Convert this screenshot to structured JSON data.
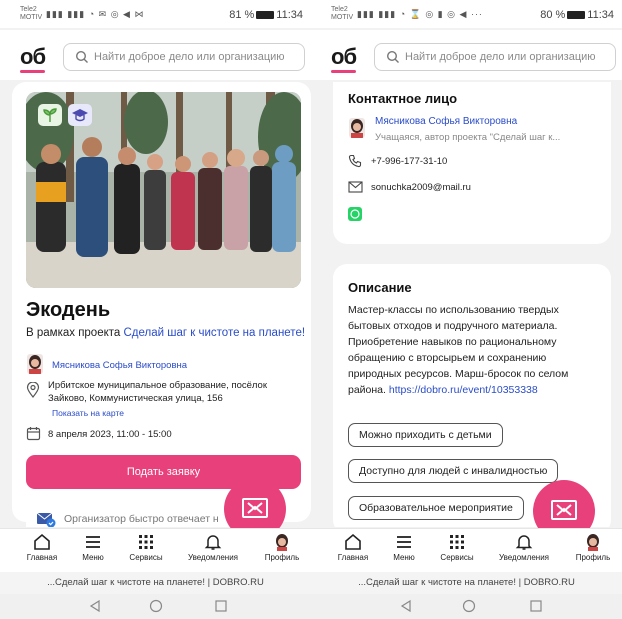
{
  "left": {
    "status": {
      "carrier": "Tele2\nMOTIV",
      "battery": "81 %",
      "time": "11:34"
    },
    "search_placeholder": "Найти доброе дело или организацию",
    "event": {
      "title": "Экодень",
      "project_prefix": "В рамках проекта ",
      "project_link": "Сделай шаг к чистоте на планете!",
      "organizer": "Мясникова Софья Викторовна",
      "address": "Ирбитское муниципальное образование, посёлок Зайково, Коммунистическая улица, 156",
      "map_link": "Показать на карте",
      "date": "8 апреля 2023, 11:00 - 15:00",
      "apply_button": "Подать заявку",
      "note": "Организатор быстро отвечает н"
    }
  },
  "right": {
    "status": {
      "carrier": "Tele2\nMOTIV",
      "battery": "80 %",
      "time": "11:34"
    },
    "search_placeholder": "Найти доброе дело или организацию",
    "contact": {
      "heading": "Контактное лицо",
      "name": "Мясникова Софья Викторовна",
      "role": "Учащаяся, автор проекта \"Сделай шаг к...",
      "phone": "+7-996-177-31-10",
      "email": "sonuchka2009@mail.ru"
    },
    "description": {
      "heading": "Описание",
      "lines": [
        "Мастер-классы по использованию твердых",
        "бытовых отходов и подручного материала.",
        "Приобретение навыков по рациональному",
        "обращению с вторсырьем и сохранению",
        "природных ресурсов. Марш-бросок по селом",
        "района."
      ],
      "link": "https://dobro.ru/event/10353338",
      "tags": [
        "Можно приходить с детьми",
        "Доступно для людей с инвалидностью",
        "Образовательное мероприятие"
      ]
    }
  },
  "nav": {
    "home": "Главная",
    "menu": "Меню",
    "services": "Сервисы",
    "notifications": "Уведомления",
    "profile": "Профиль"
  },
  "url_bar": "...Сделай шаг к чистоте на планете! | DOBRO.RU",
  "colors": {
    "accent": "#e8407a",
    "link": "#2a4cc9",
    "whatsapp": "#25d366"
  }
}
